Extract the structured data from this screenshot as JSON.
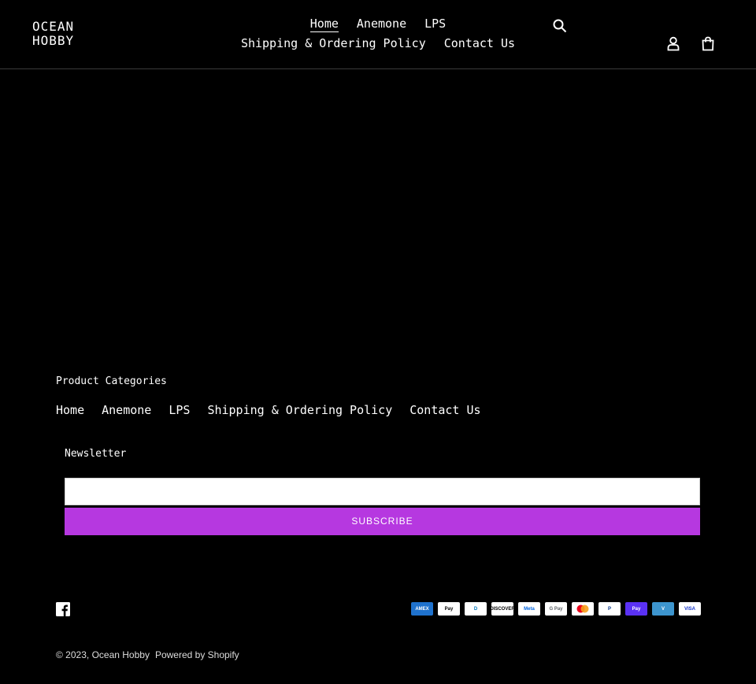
{
  "header": {
    "logo_line1": "OCEAN",
    "logo_line2": "HOBBY",
    "nav": [
      "Home",
      "Anemone",
      "LPS",
      "Shipping & Ordering Policy",
      "Contact Us"
    ],
    "search_icon": "search-icon",
    "account_icon": "user-icon",
    "cart_icon": "cart-icon"
  },
  "footer": {
    "categories_title": "Product Categories",
    "links": [
      "Home",
      "Anemone",
      "LPS",
      "Shipping & Ordering Policy",
      "Contact Us"
    ],
    "newsletter_title": "Newsletter",
    "email_value": "",
    "subscribe_label": "SUBSCRIBE",
    "social_icon": "facebook-icon",
    "payments": [
      {
        "name": "AMEX",
        "bg": "#1f72cd",
        "fg": "#ffffff"
      },
      {
        "name": "Pay",
        "bg": "#ffffff",
        "fg": "#000000"
      },
      {
        "name": "D",
        "bg": "#ffffff",
        "fg": "#0079be"
      },
      {
        "name": "DISCOVER",
        "bg": "#ffffff",
        "fg": "#000000"
      },
      {
        "name": "Meta",
        "bg": "#ffffff",
        "fg": "#0064e0"
      },
      {
        "name": "G Pay",
        "bg": "#ffffff",
        "fg": "#5f6368"
      },
      {
        "name": "",
        "bg": "#ffffff",
        "fg": "#eb001b"
      },
      {
        "name": "P",
        "bg": "#ffffff",
        "fg": "#003087"
      },
      {
        "name": "Pay",
        "bg": "#5a31f4",
        "fg": "#ffffff"
      },
      {
        "name": "V",
        "bg": "#3d95ce",
        "fg": "#ffffff"
      },
      {
        "name": "VISA",
        "bg": "#ffffff",
        "fg": "#1434cb"
      }
    ],
    "copyright_prefix": "© 2023,",
    "store_name": "Ocean Hobby",
    "powered_by": "Powered by Shopify"
  },
  "colors": {
    "background": "#000000",
    "subscribe_button": "#b638e0",
    "text": "#ffffff"
  }
}
